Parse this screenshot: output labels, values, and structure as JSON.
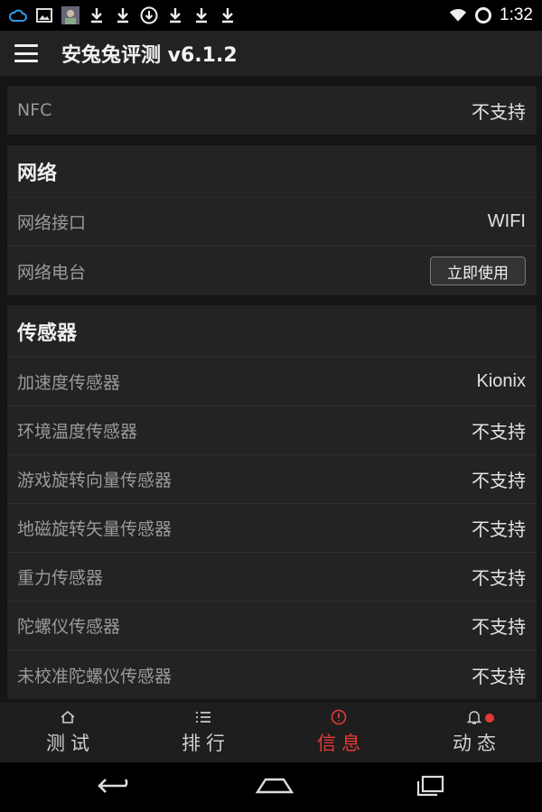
{
  "status_bar": {
    "left_icons": [
      "cloud-icon",
      "image-icon",
      "avatar-icon",
      "download-icon",
      "download-icon",
      "download-circle-icon",
      "download-icon",
      "download-icon",
      "download-icon"
    ],
    "time": "1:32"
  },
  "app_bar": {
    "title": "安兔兔评测 v6.1.2"
  },
  "top_card": {
    "rows": [
      {
        "label": "NFC",
        "value": "不支持"
      }
    ]
  },
  "network": {
    "title": "网络",
    "rows": [
      {
        "label": "网络接口",
        "value": "WIFI"
      },
      {
        "label": "网络电台",
        "button": "立即使用"
      }
    ]
  },
  "sensors": {
    "title": "传感器",
    "rows": [
      {
        "label": "加速度传感器",
        "value": "Kionix"
      },
      {
        "label": "环境温度传感器",
        "value": "不支持"
      },
      {
        "label": "游戏旋转向量传感器",
        "value": "不支持"
      },
      {
        "label": "地磁旋转矢量传感器",
        "value": "不支持"
      },
      {
        "label": "重力传感器",
        "value": "不支持"
      },
      {
        "label": "陀螺仪传感器",
        "value": "不支持"
      },
      {
        "label": "未校准陀螺仪传感器",
        "value": "不支持"
      }
    ]
  },
  "bottom_nav": {
    "items": [
      {
        "label": "测试",
        "icon": "home-icon",
        "active": false
      },
      {
        "label": "排行",
        "icon": "list-icon",
        "active": false
      },
      {
        "label": "信息",
        "icon": "info-icon",
        "active": true
      },
      {
        "label": "动态",
        "icon": "bell-icon",
        "active": false,
        "badge": true
      }
    ]
  },
  "colors": {
    "accent": "#e53935",
    "background": "#151515",
    "card": "#232323"
  }
}
